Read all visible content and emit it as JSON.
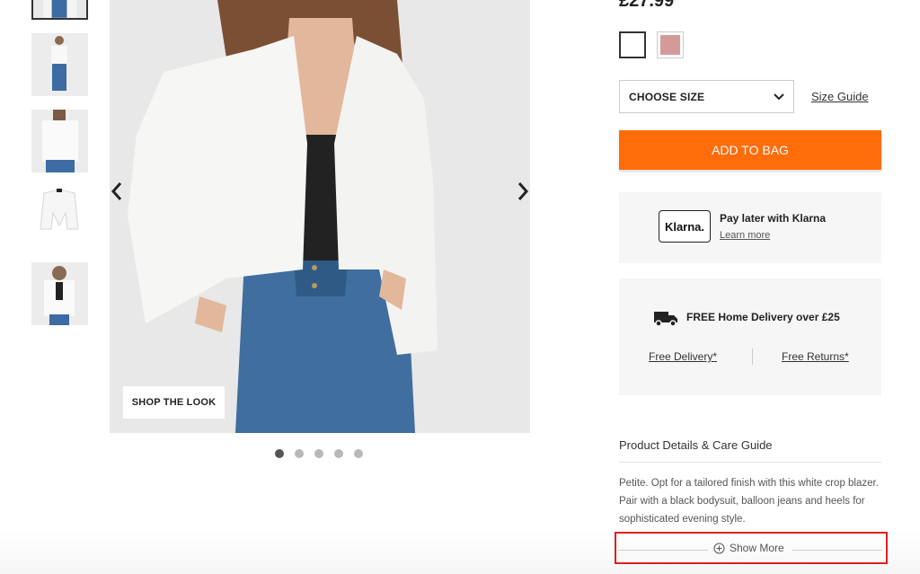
{
  "product": {
    "price": "£27.99",
    "colors": [
      "#ffffff",
      "#d49a99"
    ],
    "size_select_label": "CHOOSE SIZE",
    "size_guide_label": "Size Guide",
    "add_to_bag_label": "ADD TO BAG"
  },
  "gallery": {
    "shop_the_look_label": "SHOP THE LOOK",
    "thumbnail_count": 5,
    "active_dot": 1,
    "dot_count": 5
  },
  "klarna": {
    "logo_text": "Klarna.",
    "title": "Pay later with Klarna",
    "link": "Learn more"
  },
  "delivery": {
    "title": "FREE Home Delivery over £25",
    "free_delivery_link": "Free Delivery*",
    "free_returns_link": "Free Returns*"
  },
  "details": {
    "heading": "Product Details & Care Guide",
    "description": "Petite. Opt for a tailored finish with this white crop blazer. Pair with a black bodysuit, balloon jeans and heels for sophisticated evening style.",
    "show_more_label": "Show More"
  },
  "colors": {
    "accent": "#ff6d0a",
    "highlight": "#e02020",
    "panel_bg": "#f6f6f6"
  }
}
